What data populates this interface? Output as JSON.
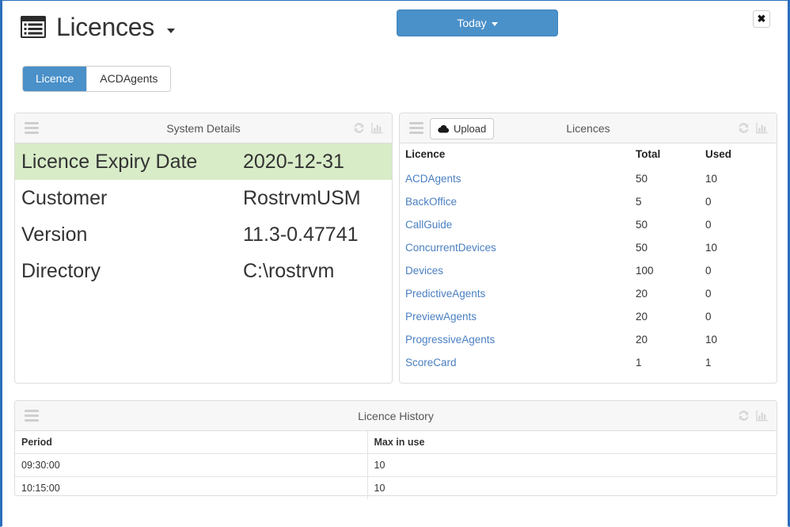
{
  "header": {
    "title": "Licences",
    "title_icon": "list-alt-icon",
    "caret_icon": "caret-down-icon",
    "today_button": "Today",
    "close_button": "✖"
  },
  "tabs": [
    {
      "label": "Licence",
      "active": true
    },
    {
      "label": "ACDAgents",
      "active": false
    }
  ],
  "panels": {
    "system_details": {
      "title": "System Details",
      "menu_icon": "hamburger-icon",
      "refresh_icon": "refresh-icon",
      "chart_icon": "bar-chart-icon",
      "rows": [
        {
          "key": "Licence Expiry Date",
          "value": "2020-12-31",
          "highlight": true
        },
        {
          "key": "Customer",
          "value": "RostrvmUSM",
          "highlight": false
        },
        {
          "key": "Version",
          "value": "11.3-0.47741",
          "highlight": false
        },
        {
          "key": "Directory",
          "value": "C:\\rostrvm",
          "highlight": false
        }
      ]
    },
    "licences": {
      "title": "Licences",
      "menu_icon": "hamburger-icon",
      "refresh_icon": "refresh-icon",
      "chart_icon": "bar-chart-icon",
      "upload_button": "Upload",
      "upload_icon": "cloud-upload-icon",
      "columns": [
        "Licence",
        "Total",
        "Used"
      ],
      "rows": [
        {
          "licence": "ACDAgents",
          "total": "50",
          "used": "10"
        },
        {
          "licence": "BackOffice",
          "total": "5",
          "used": "0"
        },
        {
          "licence": "CallGuide",
          "total": "50",
          "used": "0"
        },
        {
          "licence": "ConcurrentDevices",
          "total": "50",
          "used": "10"
        },
        {
          "licence": "Devices",
          "total": "100",
          "used": "0"
        },
        {
          "licence": "PredictiveAgents",
          "total": "20",
          "used": "0"
        },
        {
          "licence": "PreviewAgents",
          "total": "20",
          "used": "0"
        },
        {
          "licence": "ProgressiveAgents",
          "total": "20",
          "used": "10"
        },
        {
          "licence": "ScoreCard",
          "total": "1",
          "used": "1"
        }
      ]
    },
    "licence_history": {
      "title": "Licence History",
      "menu_icon": "hamburger-icon",
      "refresh_icon": "refresh-icon",
      "chart_icon": "bar-chart-icon",
      "columns": [
        "Period",
        "Max in use"
      ],
      "rows": [
        {
          "period": "09:30:00",
          "max_in_use": "10"
        },
        {
          "period": "10:15:00",
          "max_in_use": "10"
        }
      ]
    }
  },
  "colors": {
    "accent": "#4a90c9",
    "link": "#4a7fc1",
    "highlight_row": "#d8ecc8",
    "panel_header": "#f7f7f7",
    "window_border": "#2a6ebb"
  }
}
